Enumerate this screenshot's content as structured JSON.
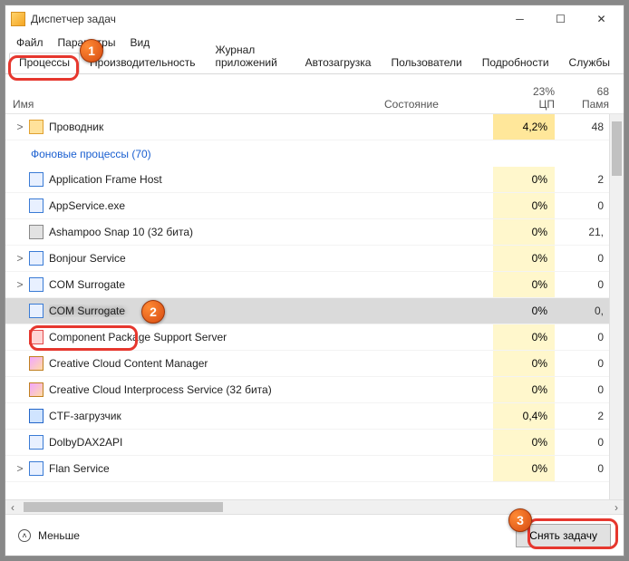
{
  "window": {
    "title": "Диспетчер задач"
  },
  "menu": {
    "file": "Файл",
    "options": "Параметры",
    "view": "Вид"
  },
  "tabs": {
    "items": [
      "Процессы",
      "Производительность",
      "Журнал приложений",
      "Автозагрузка",
      "Пользователи",
      "Подробности",
      "Службы"
    ]
  },
  "columns": {
    "name": "Имя",
    "state": "Состояние",
    "cpu_pct": "23%",
    "cpu_label": "ЦП",
    "mem_val": "68",
    "mem_label": "Памя"
  },
  "section_bg": "Фоновые процессы (70)",
  "rows": [
    {
      "exp": ">",
      "name": "Проводник",
      "cpu": "4,2%",
      "mem": "48",
      "cpu_high": true,
      "ico": "folder"
    },
    {
      "section": true
    },
    {
      "exp": "",
      "name": "Application Frame Host",
      "cpu": "0%",
      "mem": "2"
    },
    {
      "exp": "",
      "name": "AppService.exe",
      "cpu": "0%",
      "mem": "0"
    },
    {
      "exp": "",
      "name": "Ashampoo Snap 10 (32 бита)",
      "cpu": "0%",
      "mem": "21,",
      "ico": "ash"
    },
    {
      "exp": ">",
      "name": "Bonjour Service",
      "cpu": "0%",
      "mem": "0"
    },
    {
      "exp": ">",
      "name": "COM Surrogate",
      "cpu": "0%",
      "mem": "0"
    },
    {
      "exp": "",
      "name": "COM Surrogate",
      "cpu": "0%",
      "mem": "0,",
      "sel": true,
      "blur": true
    },
    {
      "exp": "",
      "name": "Component Package Support Server",
      "cpu": "0%",
      "mem": "0",
      "ico": "cc"
    },
    {
      "exp": "",
      "name": "Creative Cloud Content Manager",
      "cpu": "0%",
      "mem": "0",
      "ico": "cc2"
    },
    {
      "exp": "",
      "name": "Creative Cloud Interprocess Service (32 бита)",
      "cpu": "0%",
      "mem": "0",
      "ico": "cc2"
    },
    {
      "exp": "",
      "name": "CTF-загрузчик",
      "cpu": "0,4%",
      "mem": "2",
      "ico": "ctf"
    },
    {
      "exp": "",
      "name": "DolbyDAX2API",
      "cpu": "0%",
      "mem": "0"
    },
    {
      "exp": ">",
      "name": "Flan Service",
      "cpu": "0%",
      "mem": "0"
    }
  ],
  "footer": {
    "less": "Меньше",
    "end_task": "Снять задачу"
  },
  "badges": {
    "b1": "1",
    "b2": "2",
    "b3": "3"
  }
}
